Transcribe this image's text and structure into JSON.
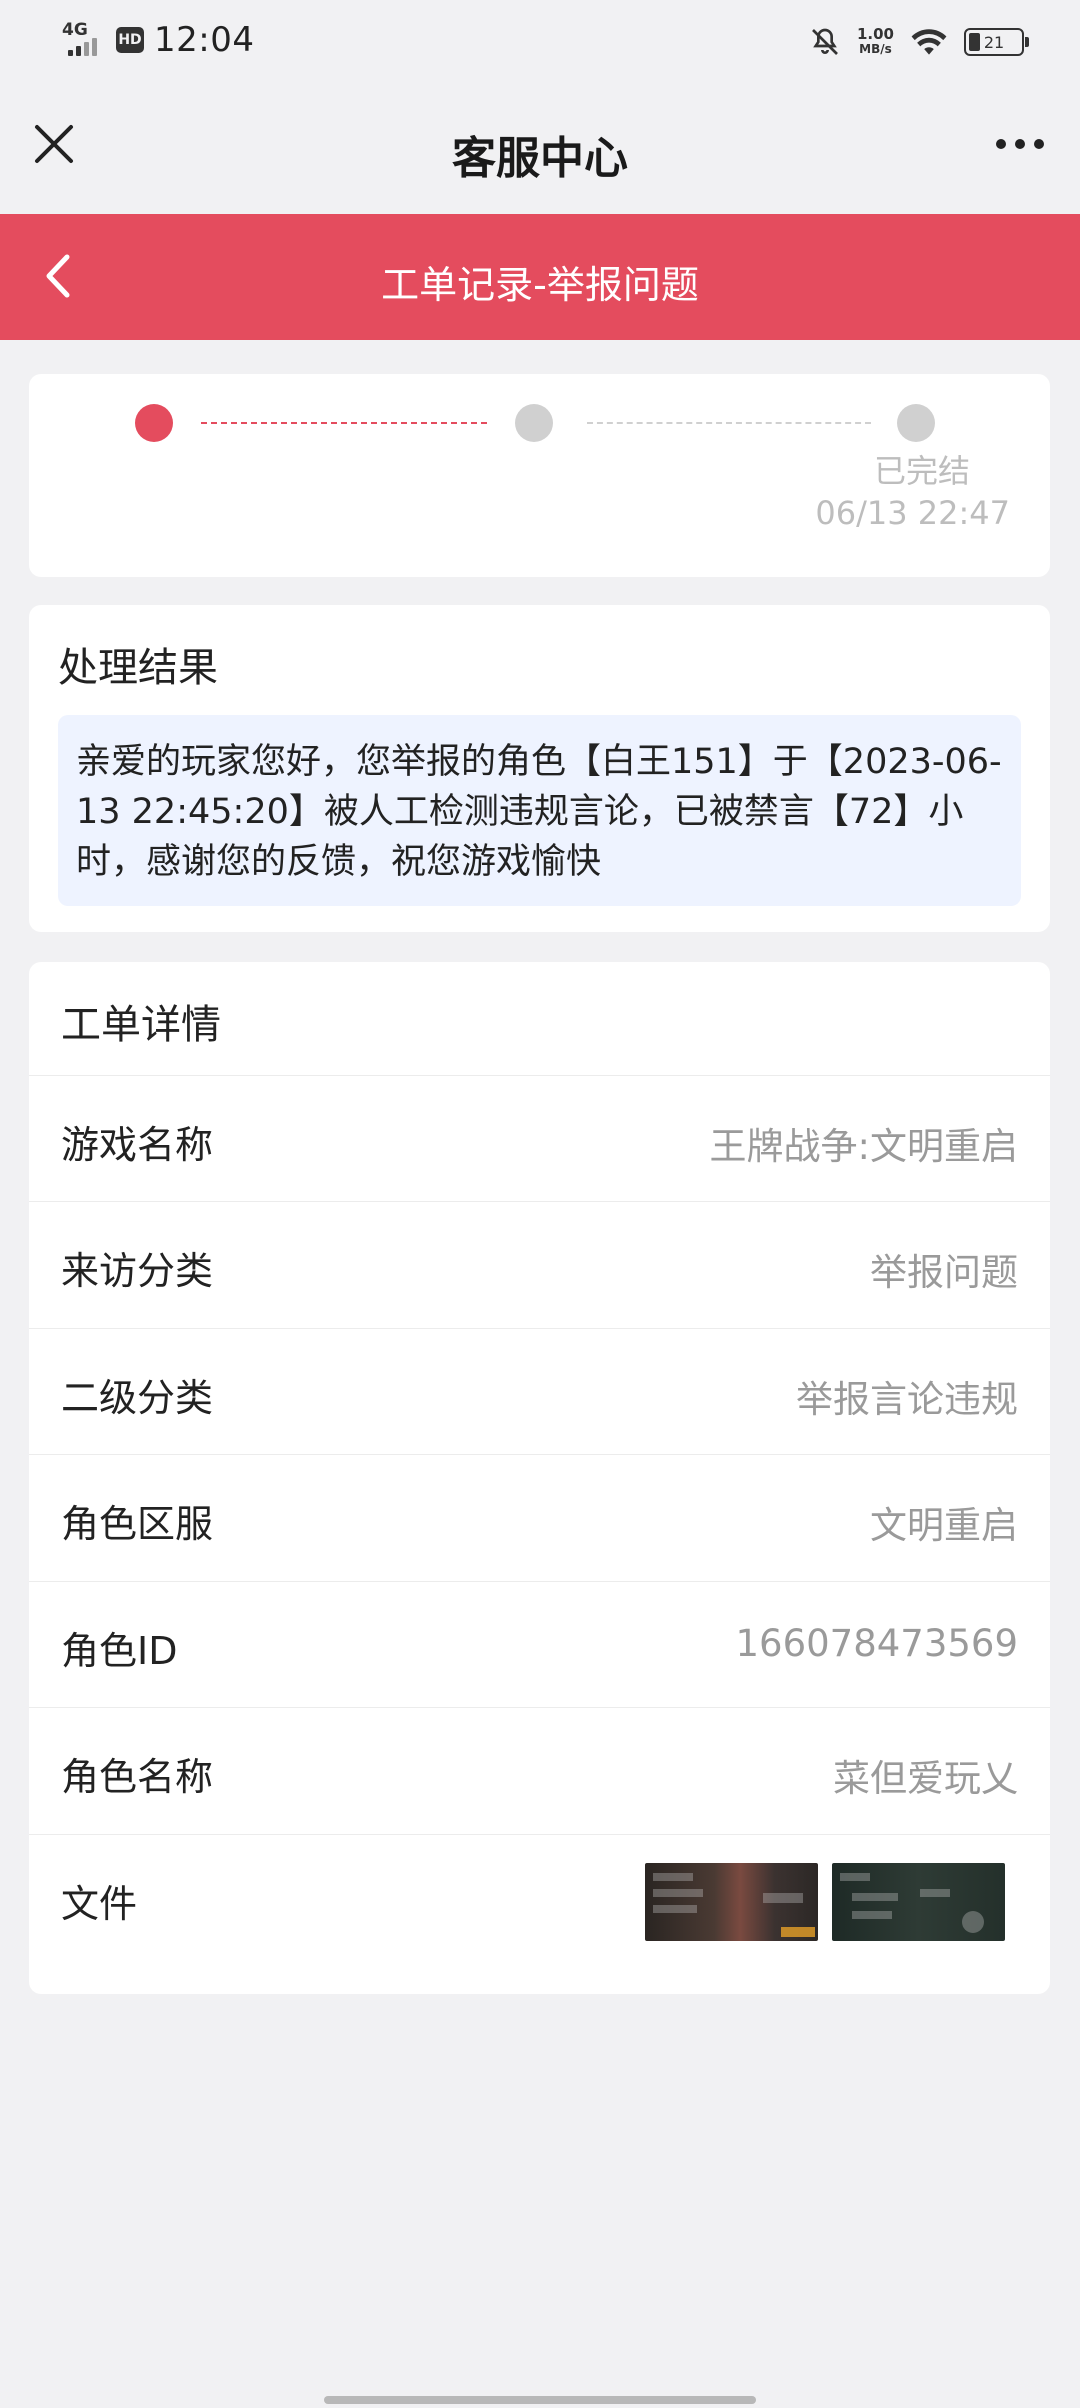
{
  "status_bar": {
    "network": "4G",
    "hd": "HD",
    "time": "12:04",
    "speed_value": "1.00",
    "speed_unit": "MB/s",
    "battery": "21"
  },
  "header": {
    "title": "客服中心",
    "close_icon": "close-icon",
    "more_icon": "more-icon"
  },
  "nav": {
    "title": "工单记录-举报问题",
    "back_icon": "chevron-left-icon",
    "background_color": "#e44c5e"
  },
  "progress": {
    "steps_total": 3,
    "current_step": 1,
    "status_label": "已完结",
    "status_time": "06/13 22:47"
  },
  "result": {
    "title": "处理结果",
    "content": "亲爱的玩家您好，您举报的角色【白王151】于【2023-06-13 22:45:20】被人工检测违规言论，已被禁言【72】小时，感谢您的反馈，祝您游戏愉快"
  },
  "details": {
    "title": "工单详情",
    "rows": [
      {
        "label": "游戏名称",
        "value": "王牌战争:文明重启"
      },
      {
        "label": "来访分类",
        "value": "举报问题"
      },
      {
        "label": "二级分类",
        "value": "举报言论违规"
      },
      {
        "label": "角色区服",
        "value": "文明重启"
      },
      {
        "label": "角色ID",
        "value": "166078473569"
      },
      {
        "label": "角色名称",
        "value": "菜但爱玩乂"
      }
    ],
    "files_label": "文件"
  }
}
